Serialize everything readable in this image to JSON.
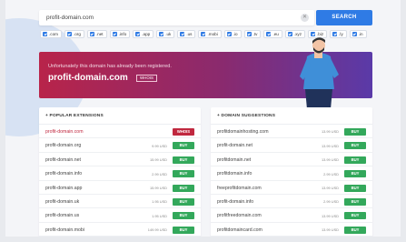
{
  "search": {
    "value": "profit-domain.com",
    "clear_icon": "close-icon",
    "button_label": "SEARCH"
  },
  "tlds": [
    ".com",
    ".org",
    ".net",
    ".info",
    ".app",
    ".uk",
    ".us",
    ".mobi",
    ".io",
    ".tv",
    ".eu",
    ".xyz",
    ".biz",
    ".ly",
    ".in"
  ],
  "banner": {
    "message": "Unfortunately this domain has already been registered.",
    "domain": "profit-domain.com",
    "whois_label": "WHOIS"
  },
  "popular": {
    "title": "POPULAR EXTENSIONS",
    "rows": [
      {
        "name": "profit-domain.com",
        "price": "",
        "action": "WHOIS"
      },
      {
        "name": "profit-domain.org",
        "price": "9.99 USD",
        "action": "BUY"
      },
      {
        "name": "profit-domain.net",
        "price": "15.99 USD",
        "action": "BUY"
      },
      {
        "name": "profit-domain.info",
        "price": "2.99 USD",
        "action": "BUY"
      },
      {
        "name": "profit-domain.app",
        "price": "15.99 USD",
        "action": "BUY"
      },
      {
        "name": "profit-domain.uk",
        "price": "1.95 USD",
        "action": "BUY"
      },
      {
        "name": "profit-domain.us",
        "price": "1.95 USD",
        "action": "BUY"
      },
      {
        "name": "profit-domain.mobi",
        "price": "149.99 USD",
        "action": "BUY"
      }
    ]
  },
  "suggestions": {
    "title": "DOMAIN SUGGESTIONS",
    "rows": [
      {
        "name": "profitdomainhosting.com",
        "price": "13.99 USD",
        "action": "BUY"
      },
      {
        "name": "profit-domain.net",
        "price": "13.99 USD",
        "action": "BUY"
      },
      {
        "name": "profitdomain.net",
        "price": "13.99 USD",
        "action": "BUY"
      },
      {
        "name": "profitdomain.info",
        "price": "2.99 USD",
        "action": "BUY"
      },
      {
        "name": "freeprofitdomain.com",
        "price": "13.99 USD",
        "action": "BUY"
      },
      {
        "name": "profit-domain.info",
        "price": "2.99 USD",
        "action": "BUY"
      },
      {
        "name": "profitfreedomain.com",
        "price": "13.99 USD",
        "action": "BUY"
      },
      {
        "name": "profitdomaincard.com",
        "price": "13.99 USD",
        "action": "BUY"
      }
    ]
  },
  "colors": {
    "accent": "#2f7be5",
    "buy": "#33a85b",
    "whois": "#c0283f"
  }
}
